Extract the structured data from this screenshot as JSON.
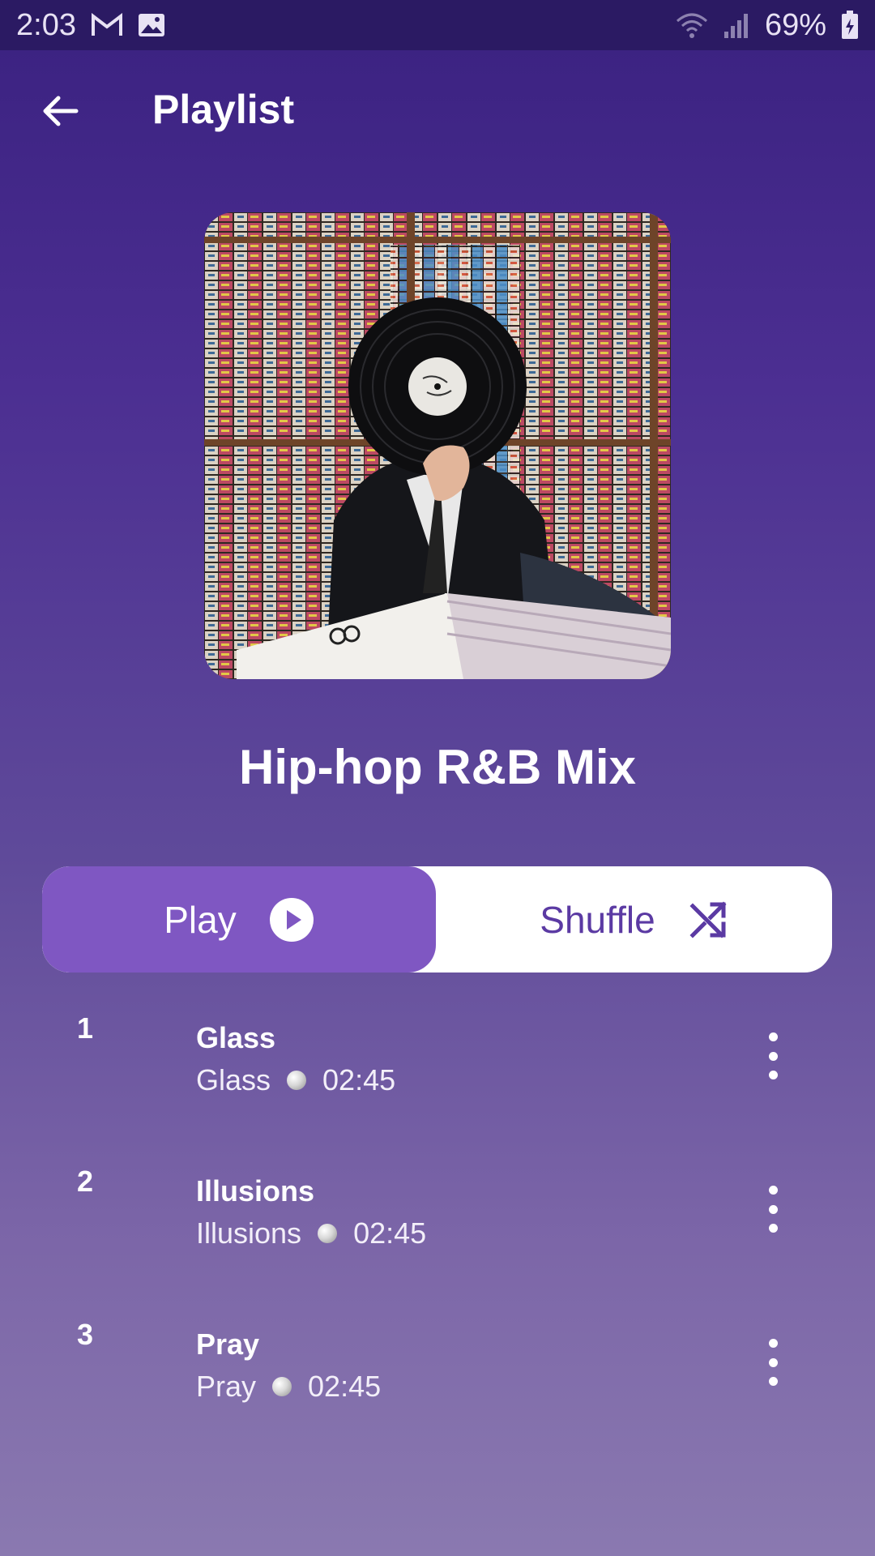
{
  "status_bar": {
    "time": "2:03",
    "battery": "69%",
    "icons": [
      "gmail-icon",
      "image-icon",
      "wifi-icon",
      "signal-icon",
      "battery-icon"
    ]
  },
  "header": {
    "title": "Playlist",
    "back_icon": "arrow-back-icon"
  },
  "playlist": {
    "name": "Hip-hop R&B Mix",
    "cover": "vinyl-record-cover-image"
  },
  "actions": {
    "play_label": "Play",
    "shuffle_label": "Shuffle",
    "accent_color": "#7f57c2",
    "shuffle_color": "#5b3aa3"
  },
  "tracks": [
    {
      "number": "1",
      "title": "Glass",
      "artist": "Glass",
      "duration": "02:45"
    },
    {
      "number": "2",
      "title": "Illusions",
      "artist": "Illusions",
      "duration": "02:45"
    },
    {
      "number": "3",
      "title": "Pray",
      "artist": "Pray",
      "duration": "02:45"
    }
  ]
}
